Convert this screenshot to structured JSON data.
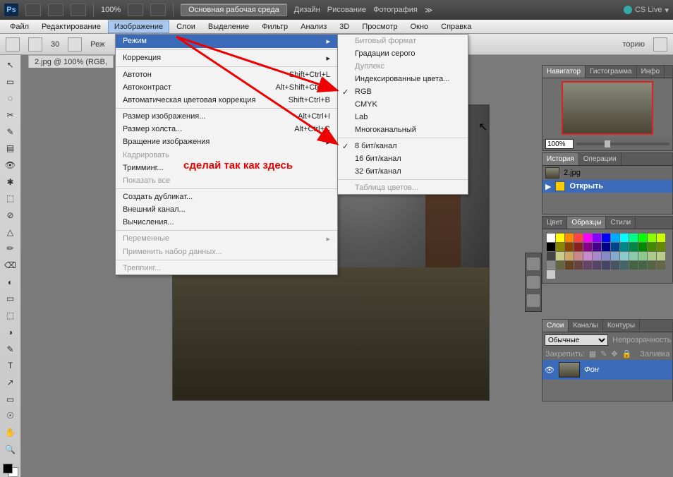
{
  "app": {
    "ps_label": "Ps",
    "zoom": "100%",
    "cslive": "CS Live"
  },
  "workspace": {
    "active": "Основная рабочая среда",
    "items": [
      "Дизайн",
      "Рисование",
      "Фотография"
    ],
    "more": "≫"
  },
  "menubar": [
    "Файл",
    "Редактирование",
    "Изображение",
    "Слои",
    "Выделение",
    "Фильтр",
    "Анализ",
    "3D",
    "Просмотр",
    "Окно",
    "Справка"
  ],
  "menubar_active_index": 2,
  "optbar": {
    "brush_size": "30",
    "mode_prefix": "Реж",
    "history_label": "торию"
  },
  "doc_tab": "2.jpg @ 100% (RGB,",
  "image_menu": {
    "header": "Режим",
    "groups": [
      [
        {
          "label": "Коррекция",
          "sub": true
        }
      ],
      [
        {
          "label": "Автотон",
          "sc": "Shift+Ctrl+L"
        },
        {
          "label": "Автоконтраст",
          "sc": "Alt+Shift+Ctrl+L"
        },
        {
          "label": "Автоматическая цветовая коррекция",
          "sc": "Shift+Ctrl+B"
        }
      ],
      [
        {
          "label": "Размер изображения...",
          "sc": "Alt+Ctrl+I"
        },
        {
          "label": "Размер холста...",
          "sc": "Alt+Ctrl+C"
        },
        {
          "label": "Вращение изображения",
          "sub": true
        },
        {
          "label": "Кадрировать",
          "disabled": true
        },
        {
          "label": "Тримминг..."
        },
        {
          "label": "Показать все",
          "disabled": true
        }
      ],
      [
        {
          "label": "Создать дубликат..."
        },
        {
          "label": "Внешний канал..."
        },
        {
          "label": "Вычисления..."
        }
      ],
      [
        {
          "label": "Переменные",
          "sub": true,
          "disabled": true
        },
        {
          "label": "Применить набор данных...",
          "disabled": true
        }
      ],
      [
        {
          "label": "Треппинг...",
          "disabled": true
        }
      ]
    ]
  },
  "mode_submenu": {
    "groups": [
      [
        {
          "label": "Битовый формат",
          "disabled": true
        },
        {
          "label": "Градации серого"
        },
        {
          "label": "Дуплекс",
          "disabled": true
        },
        {
          "label": "Индексированные цвета..."
        },
        {
          "label": "RGB",
          "checked": true
        },
        {
          "label": "CMYK"
        },
        {
          "label": "Lab"
        },
        {
          "label": "Многоканальный"
        }
      ],
      [
        {
          "label": "8 бит/канал",
          "checked": true
        },
        {
          "label": "16 бит/канал"
        },
        {
          "label": "32 бит/канал"
        }
      ],
      [
        {
          "label": "Таблица цветов...",
          "disabled": true
        }
      ]
    ]
  },
  "annotation": "сделай так как здесь",
  "panels": {
    "navigator": {
      "tabs": [
        "Навигатор",
        "Гистограмма",
        "Инфо"
      ],
      "zoom": "100%"
    },
    "history": {
      "tabs": [
        "История",
        "Операции"
      ],
      "doc": "2.jpg",
      "step": "Открыть"
    },
    "color": {
      "tabs": [
        "Цвет",
        "Образцы",
        "Стили"
      ]
    },
    "layers": {
      "tabs": [
        "Слои",
        "Каналы",
        "Контуры"
      ],
      "blend": "Обычные",
      "opacity_label": "Непрозрачность",
      "lock_label": "Закрепить:",
      "fill_label": "Заливка",
      "layer_name": "Фон"
    }
  },
  "swatch_colors": [
    "#fff",
    "#ff0",
    "#f80",
    "#f44",
    "#f0f",
    "#80f",
    "#00f",
    "#0af",
    "#0ff",
    "#0f8",
    "#0f0",
    "#8f0",
    "#cf0",
    "#000",
    "#880",
    "#840",
    "#822",
    "#808",
    "#408",
    "#008",
    "#048",
    "#088",
    "#084",
    "#080",
    "#480",
    "#680",
    "#444",
    "#cc8",
    "#ca6",
    "#c88",
    "#c8c",
    "#a8c",
    "#88c",
    "#8ac",
    "#8cc",
    "#8ca",
    "#8c8",
    "#ac8",
    "#bc8",
    "#888",
    "#664",
    "#642",
    "#644",
    "#646",
    "#546",
    "#446",
    "#456",
    "#466",
    "#464",
    "#464",
    "#564",
    "#664",
    "#ccc"
  ]
}
